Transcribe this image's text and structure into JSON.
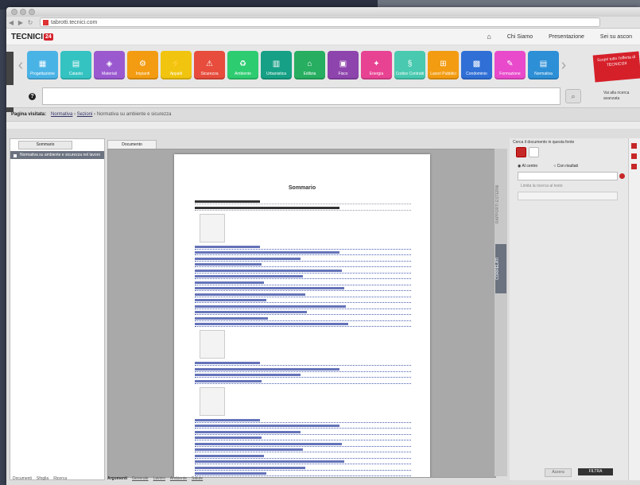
{
  "window": {
    "title": ""
  },
  "browser": {
    "url": "tabrotti.tecnici.com"
  },
  "site": {
    "logo": "TECNICI",
    "logo_badge": "24",
    "nav": [
      "Chi Siamo",
      "Presentazione",
      "Sei su ascon"
    ]
  },
  "apps": [
    {
      "label": "Progettazione",
      "color": "#4ab3e6",
      "glyph": "▦"
    },
    {
      "label": "Catasto",
      "color": "#35c3c2",
      "glyph": "▤"
    },
    {
      "label": "Materiali",
      "color": "#9b59d0",
      "glyph": "◈"
    },
    {
      "label": "Impianti",
      "color": "#f39c12",
      "glyph": "⚙"
    },
    {
      "label": "Appalti",
      "color": "#f1c40f",
      "glyph": "⚡"
    },
    {
      "label": "Sicurezza",
      "color": "#e74c3c",
      "glyph": "⚠"
    },
    {
      "label": "Ambiente",
      "color": "#2ecc71",
      "glyph": "♻"
    },
    {
      "label": "Urbanistica",
      "color": "#16a085",
      "glyph": "▥"
    },
    {
      "label": "Edilizia",
      "color": "#27ae60",
      "glyph": "⌂"
    },
    {
      "label": "Fisco",
      "color": "#8e44ad",
      "glyph": "▣"
    },
    {
      "label": "Energia",
      "color": "#e84393",
      "glyph": "✦"
    },
    {
      "label": "Codice Contratti",
      "color": "#48c9b0",
      "glyph": "§"
    },
    {
      "label": "Lavori Pubblici",
      "color": "#f39c12",
      "glyph": "⊞"
    },
    {
      "label": "Condominio",
      "color": "#2f6fd6",
      "glyph": "▩"
    },
    {
      "label": "Formazione",
      "color": "#e84acb",
      "glyph": "✎"
    },
    {
      "label": "Normativa",
      "color": "#2d8fd6",
      "glyph": "▤"
    }
  ],
  "promo": "Scopri tutto l'offerta di TECNICI24",
  "search": {
    "placeholder": "",
    "note": "Vai alla ricerca avanzata"
  },
  "breadcrumb": {
    "label": "Pagina visitata:",
    "path": [
      "Normativa",
      "Sezioni",
      "Normativa su ambiente e sicurezza"
    ]
  },
  "left": {
    "dropdown": "Sommario",
    "item": "Normativa su ambiente e sicurezza nel lavoro",
    "footer": [
      "Documenti",
      "Sfoglia",
      "Ricerca"
    ]
  },
  "viewer": {
    "tab": "Documento",
    "doc_title": "Sommario",
    "footer_label": "Argomenti",
    "footer_links": [
      "Generale",
      "Lavoro",
      "Ambiente",
      "Salute"
    ]
  },
  "side_tabs": {
    "correlati": "CORRELATI",
    "other": "RAPPORTI ESTERNI"
  },
  "right": {
    "header": "Cerca il documento in questa fonte",
    "radio1": "Al centro",
    "radio2": "Con risultati",
    "check": "Limita la ricerca al testo",
    "btn_reset": "Azzera",
    "btn_go": "FILTRA"
  }
}
